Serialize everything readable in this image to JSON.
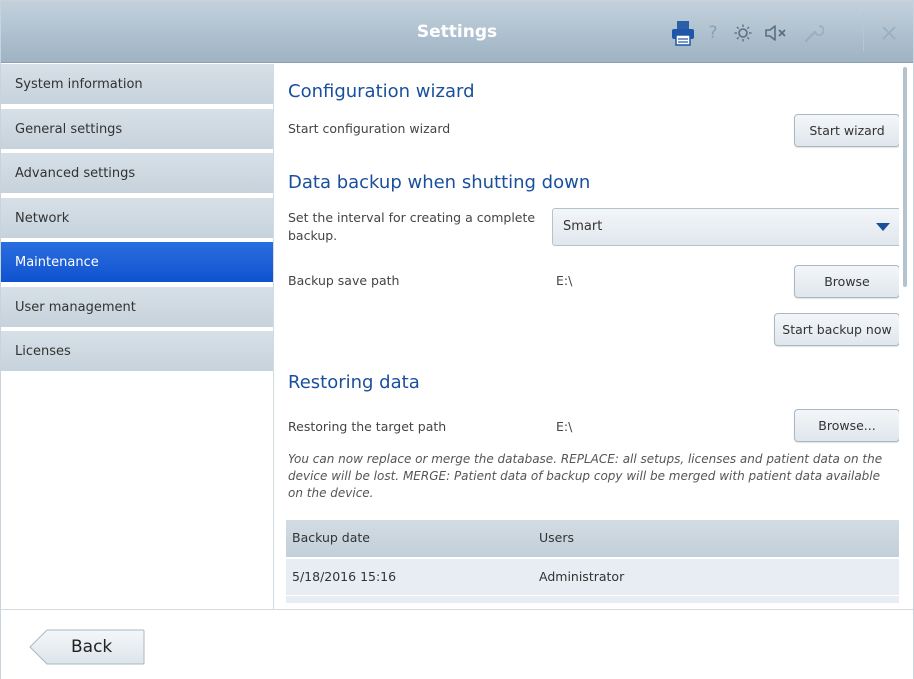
{
  "header": {
    "title": "Settings",
    "icons": [
      "printer-icon",
      "help-icon",
      "brightness-icon",
      "mute-icon",
      "wrench-icon",
      "close-icon"
    ]
  },
  "sidebar": {
    "items": [
      {
        "label": "System information"
      },
      {
        "label": "General settings"
      },
      {
        "label": "Advanced settings"
      },
      {
        "label": "Network"
      },
      {
        "label": "Maintenance",
        "active": true
      },
      {
        "label": "User management"
      },
      {
        "label": "Licenses"
      }
    ]
  },
  "config_wizard": {
    "title": "Configuration wizard",
    "label": "Start configuration wizard",
    "button": "Start wizard"
  },
  "backup": {
    "title": "Data backup when shutting down",
    "interval_label_line1": "Set the interval for creating a complete",
    "interval_label_line2": "backup.",
    "interval_value": "Smart",
    "path_label": "Backup save path",
    "path_value": "E:\\",
    "browse_button": "Browse",
    "start_button": "Start backup now"
  },
  "restore": {
    "title": "Restoring data",
    "target_label": "Restoring the target path",
    "target_value": "E:\\",
    "browse_button": "Browse...",
    "note": "You can now replace or merge the database. REPLACE: all setups, licenses and patient data on the device will be lost. MERGE: Patient data of backup copy will be merged with patient data available on the device.",
    "table": {
      "columns": [
        "Backup date",
        "Users"
      ],
      "rows": [
        [
          "5/18/2016 15:16",
          "Administrator"
        ]
      ]
    }
  },
  "footer": {
    "back_label": "Back"
  },
  "colors": {
    "accent": "#1a4f9c",
    "active_item": "#1558d6",
    "titlebar": "#aebfcd"
  }
}
